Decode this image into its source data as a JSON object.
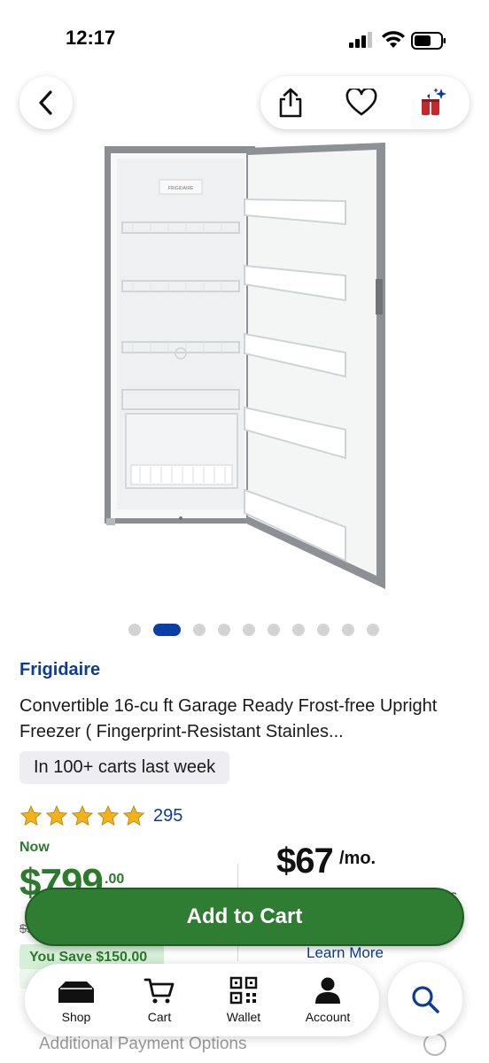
{
  "status_bar": {
    "time": "12:17"
  },
  "nav": {
    "back_icon": "chevron-left-icon",
    "share_icon": "share-icon",
    "favorite_icon": "heart-icon",
    "gift_icon": "sparkle-gift-icon"
  },
  "carousel": {
    "total_images": 10,
    "active_index": 1
  },
  "product": {
    "brand": "Frigidaire",
    "title": "Convertible 16-cu ft Garage Ready Frost-free Upright Freezer ( Fingerprint-Resistant Stainles...",
    "carts_badge": "In 100+ carts last week",
    "rating": 5,
    "review_count": "295"
  },
  "pricing": {
    "now_label": "Now",
    "price_dollars": "$799",
    "price_cents": ".00",
    "was_price": "$949.00",
    "monthly_amount": "$67",
    "monthly_unit": "/mo.",
    "trailing_text": "s",
    "save_badge": "You Save $150.00",
    "learn_more": "Learn More"
  },
  "cta": {
    "add_to_cart": "Add to Cart"
  },
  "bottom_nav": {
    "items": [
      {
        "label": "Shop",
        "icon": "shop-icon"
      },
      {
        "label": "Cart",
        "icon": "cart-icon"
      },
      {
        "label": "Wallet",
        "icon": "qr-wallet-icon"
      },
      {
        "label": "Account",
        "icon": "person-icon"
      }
    ],
    "search_icon": "search-icon"
  },
  "footer": {
    "additional_options": "Additional Payment Options"
  },
  "colors": {
    "brand_blue": "#0d3b9a",
    "price_green": "#2c7a2c",
    "cta_green": "#2e7d32",
    "badge_bg": "#eeeef2",
    "save_bg": "#d6f0d8",
    "star_gold": "#f2b21b"
  }
}
